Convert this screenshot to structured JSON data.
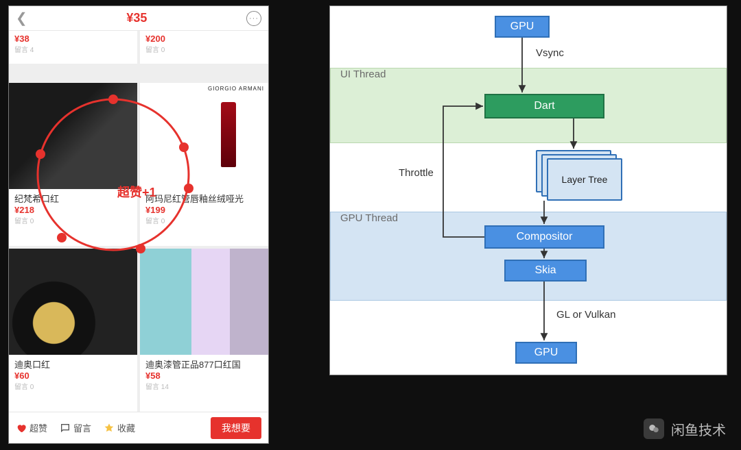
{
  "phone": {
    "title": "¥35",
    "overlay_label": "超赞+1",
    "row_top": [
      {
        "price": "¥38",
        "comments": "留言 4"
      },
      {
        "price": "¥200",
        "comments": "留言 0"
      }
    ],
    "row_mid": [
      {
        "name": "纪梵希口红",
        "price": "¥218",
        "comments": "留言 0"
      },
      {
        "name": "阿玛尼红管唇釉丝绒哑光",
        "price": "¥199",
        "comments": "留言 0"
      }
    ],
    "row_bot": [
      {
        "name": "迪奥口红",
        "price": "¥60",
        "comments": "留言 0"
      },
      {
        "name": "迪奥漆管正品877口红国",
        "price": "¥58",
        "comments": "留言 14"
      }
    ],
    "actions": {
      "like": "超赞",
      "msg": "留言",
      "fav": "收藏",
      "want": "我想要"
    }
  },
  "diagram": {
    "lanes": {
      "ui": "UI Thread",
      "gpu": "GPU Thread"
    },
    "nodes": {
      "gpu_top": "GPU",
      "dart": "Dart",
      "layer_tree": "Layer Tree",
      "compositor": "Compositor",
      "skia": "Skia",
      "gpu_bot": "GPU"
    },
    "edges": {
      "vsync": "Vsync",
      "throttle": "Throttle",
      "gl": "GL or Vulkan"
    }
  },
  "watermark": "闲鱼技术"
}
